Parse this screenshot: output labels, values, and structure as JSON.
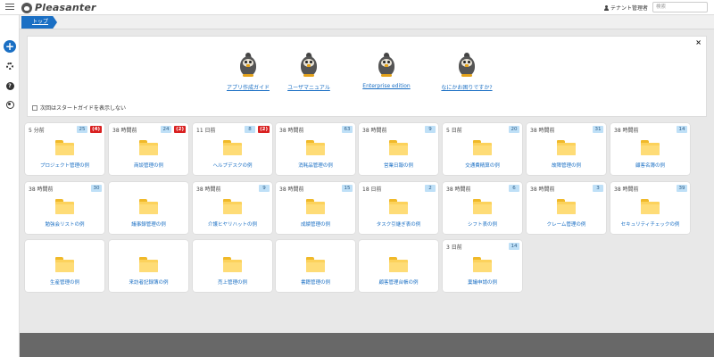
{
  "header": {
    "app_name": "Pleasanter",
    "user_label": "テナント管理者",
    "search_placeholder": "検索"
  },
  "breadcrumb": {
    "home": "トップ"
  },
  "guide": {
    "items": [
      {
        "label": "アプリ作成ガイド"
      },
      {
        "label": "ユーザマニュアル"
      },
      {
        "label": "Enterprise edition"
      },
      {
        "label": "なにかお困りですか?"
      }
    ],
    "dont_show_label": "次回はスタートガイドを表示しない",
    "close_label": "×"
  },
  "tiles": [
    {
      "time": "5 分前",
      "count": "25",
      "alert": "(4)",
      "label": "プロジェクト管理の例"
    },
    {
      "time": "38 時間前",
      "count": "24",
      "alert": "(2)",
      "label": "商談管理の例"
    },
    {
      "time": "11 日前",
      "count": "8",
      "alert": "(2)",
      "label": "ヘルプデスクの例"
    },
    {
      "time": "38 時間前",
      "count": "63",
      "alert": "",
      "label": "消耗品管理の例"
    },
    {
      "time": "38 時間前",
      "count": "9",
      "alert": "",
      "label": "営業日報の例"
    },
    {
      "time": "5 日前",
      "count": "20",
      "alert": "",
      "label": "交通費精算の例"
    },
    {
      "time": "38 時間前",
      "count": "31",
      "alert": "",
      "label": "故障管理の例"
    },
    {
      "time": "38 時間前",
      "count": "14",
      "alert": "",
      "label": "顧客名簿の例"
    },
    {
      "time": "38 時間前",
      "count": "30",
      "alert": "",
      "label": "勉強会リストの例"
    },
    {
      "time": "",
      "count": "",
      "alert": "",
      "label": "議事録管理の例"
    },
    {
      "time": "38 時間前",
      "count": "9",
      "alert": "",
      "label": "介護ヒヤリハットの例"
    },
    {
      "time": "38 時間前",
      "count": "15",
      "alert": "",
      "label": "成績管理の例"
    },
    {
      "time": "18 日前",
      "count": "2",
      "alert": "",
      "label": "タスク引継ぎ表の例"
    },
    {
      "time": "38 時間前",
      "count": "6",
      "alert": "",
      "label": "シフト表の例"
    },
    {
      "time": "38 時間前",
      "count": "3",
      "alert": "",
      "label": "クレーム管理の例"
    },
    {
      "time": "38 時間前",
      "count": "39",
      "alert": "",
      "label": "セキュリティチェックの例"
    },
    {
      "time": "",
      "count": "",
      "alert": "",
      "label": "生産管理の例"
    },
    {
      "time": "",
      "count": "",
      "alert": "",
      "label": "来訪者記録簿の例"
    },
    {
      "time": "",
      "count": "",
      "alert": "",
      "label": "売上管理の例"
    },
    {
      "time": "",
      "count": "",
      "alert": "",
      "label": "書籍管理の例"
    },
    {
      "time": "",
      "count": "",
      "alert": "",
      "label": "顧客管理台帳の例"
    },
    {
      "time": "3 日前",
      "count": "14",
      "alert": "",
      "label": "稟議申請の例"
    }
  ],
  "colors": {
    "accent": "#1a6fc4",
    "alert": "#d92020",
    "count_bg": "#bfe0f7",
    "folder": "#fcd25c"
  }
}
